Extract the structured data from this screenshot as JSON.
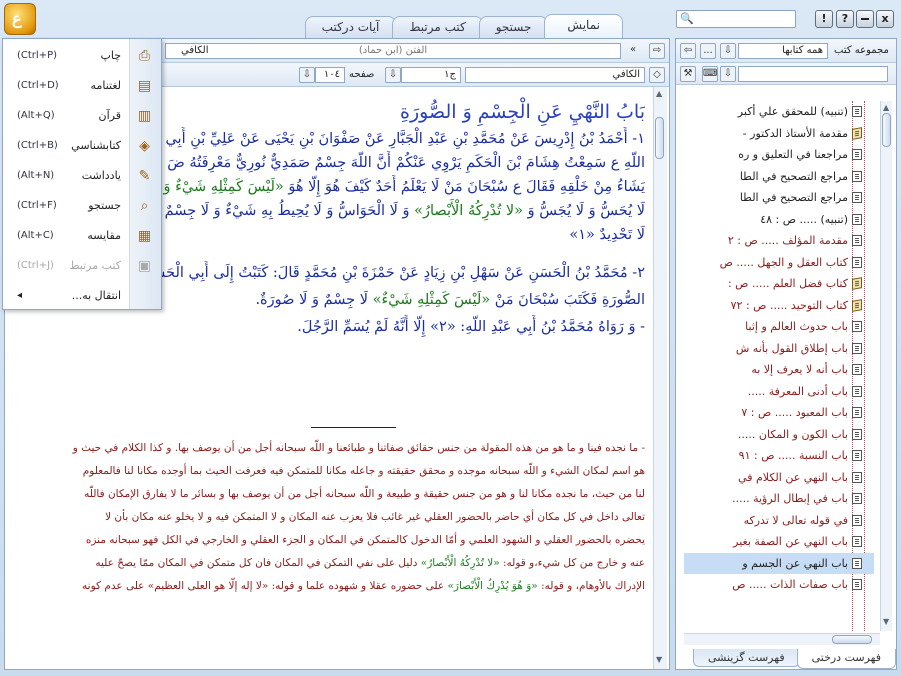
{
  "titlebar": {
    "logo_glyph": "ع",
    "tabs": [
      {
        "label": "نمایش",
        "active": true
      },
      {
        "label": "جستجو",
        "active": false
      },
      {
        "label": "کتب مرتبط",
        "active": false
      },
      {
        "label": "آیات درکتب",
        "active": false
      }
    ],
    "search_placeholder": "",
    "win_buttons": [
      "x",
      "?",
      "!"
    ]
  },
  "right_panel": {
    "collection_label": "مجموعه کتب",
    "collection_value": "همه کتابها",
    "more_label": "...",
    "tree_items": [
      {
        "label": "(تنبیه) للمحقق علي أكبر",
        "red": false,
        "icon": "page"
      },
      {
        "label": "مقدمة الأستاذ الدكتور -",
        "red": false,
        "icon": "book"
      },
      {
        "label": "مراجعنا في التعليق و ره",
        "red": false,
        "icon": "page"
      },
      {
        "label": "مراجع التصحيح في الطا",
        "red": false,
        "icon": "page"
      },
      {
        "label": "مراجع التصحيح في الطا",
        "red": false,
        "icon": "page"
      },
      {
        "label": "(تنبیه) ..... ص : ٤٨",
        "red": false,
        "icon": "page"
      },
      {
        "label": "مقدمة المؤلف ..... ص : ٢",
        "red": true,
        "icon": "page"
      },
      {
        "label": "كتاب العقل و الجهل ..... ص",
        "red": true,
        "icon": "page"
      },
      {
        "label": "كتاب فضل العلم ..... ص :",
        "red": true,
        "icon": "book"
      },
      {
        "label": "كتاب التوحيد ..... ص : ٧٢",
        "red": true,
        "icon": "book"
      },
      {
        "label": "باب حدوث العالم و إثبا",
        "red": true,
        "icon": "page"
      },
      {
        "label": "باب إطلاق القول بأنه ش",
        "red": true,
        "icon": "page"
      },
      {
        "label": "باب أنه لا يعرف إلا به",
        "red": true,
        "icon": "page"
      },
      {
        "label": "باب أدنى المعرفة .....",
        "red": true,
        "icon": "page"
      },
      {
        "label": "باب المعبود ..... ص : ٧",
        "red": true,
        "icon": "page"
      },
      {
        "label": "باب الكون و المكان .....",
        "red": true,
        "icon": "page"
      },
      {
        "label": "باب النسبة ..... ص : ٩١",
        "red": true,
        "icon": "page"
      },
      {
        "label": "باب النهي عن الكلام في",
        "red": true,
        "icon": "page"
      },
      {
        "label": "باب في إبطال الرؤية .....",
        "red": true,
        "icon": "page"
      },
      {
        "label": "في قوله تعالى لا تدركه",
        "red": true,
        "icon": "page"
      },
      {
        "label": "باب النهي عن الصفة بغير",
        "red": true,
        "icon": "page"
      },
      {
        "label": "باب النهي عن الجسم و",
        "red": false,
        "icon": "page",
        "selected": true
      },
      {
        "label": "باب صفات الذات ..... ص",
        "red": true,
        "icon": "page"
      }
    ],
    "bottom_tabs": [
      {
        "label": "فهرست درختی",
        "active": true
      },
      {
        "label": "فهرست گزینشی",
        "active": false
      }
    ]
  },
  "main_panel": {
    "book_title_field": "الكافي",
    "author_field": "الفتن (ابن حماد)",
    "book_combo": "الكافي",
    "volume_label": "ج",
    "volume_value": "١",
    "page_label": "صفحه",
    "page_value": "١٠٤",
    "heading": "بَابُ النَّهْيِ عَنِ الْجِسْمِ وَ الصُّورَةِ",
    "lines": [
      {
        "parts": [
          {
            "t": "١- أَحْمَدُ بْنُ إِدْرِيسَ عَنْ مُحَمَّدِ بْنِ عَبْدِ الْجَبَّارِ عَنْ صَفْوَانَ بْنِ يَحْيَى عَنْ عَلِيِّ بْنِ أَبِي ...",
            "c": "blue"
          }
        ]
      },
      {
        "parts": [
          {
            "t": "اللَّهِ ع سَمِعْتُ هِشَامَ بْنَ الْحَكَمِ يَرْوِي عَنْكُمْ أَنَّ اللَّهَ جِسْمٌ صَمَدِيٌّ نُورِيٌّ مَعْرِفَتُهُ ضَ",
            "c": "blue"
          }
        ]
      },
      {
        "parts": [
          {
            "t": "يَشَاءُ مِنْ خَلْقِهِ فَقَالَ ع سُبْحَانَ مَنْ لَا يَعْلَمُ أَحَدٌ كَيْفَ هُوَ إِلَّا هُوَ ",
            "c": "blue"
          },
          {
            "t": "«لَيْسَ كَمِثْلِهِ شَيْءٌ وَ هُوَ السَّمِيعُ»",
            "c": "green"
          }
        ]
      },
      {
        "parts": [
          {
            "t": "لَا يُحَسُّ وَ لَا يُجَسُّ وَ ",
            "c": "blue"
          },
          {
            "t": "«لا تُدْرِكُهُ الْأَبْصارُ»",
            "c": "green"
          },
          {
            "t": " وَ لَا الْحَوَاسُّ وَ لَا يُحِيطُ بِهِ شَيْءٌ وَ لَا جِسْمٌ وَ لَا",
            "c": "blue"
          }
        ]
      },
      {
        "parts": [
          {
            "t": "لَا تَحْدِيدٌ «١»",
            "c": "blue"
          }
        ]
      },
      {
        "parts": [
          {
            "t": "٢- مُحَمَّدُ بْنُ الْحَسَنِ عَنْ سَهْلِ بْنِ زِيَادٍ عَنْ حَمْزَةَ بْنِ مُحَمَّدٍ قَالَ: كَتَبْتُ إِلَى أَبِي الْحَسَنِ ع أَسْأَلُهُ عَنِ الْجِسْمِ وَ",
            "c": "blue"
          }
        ]
      },
      {
        "parts": [
          {
            "t": "الصُّورَةِ فَكَتَبَ سُبْحَانَ مَنْ ",
            "c": "blue"
          },
          {
            "t": "«لَيْسَ كَمِثْلِهِ شَيْءٌ»",
            "c": "green"
          },
          {
            "t": " لَا جِسْمٌ وَ لَا صُورَةٌ.",
            "c": "blue"
          }
        ]
      },
      {
        "parts": [
          {
            "t": "- وَ رَوَاهُ مُحَمَّدُ بْنُ أَبِي عَبْدِ اللَّهِ: «٢» إِلَّا أَنَّهُ لَمْ يُسَمِّ الرَّجُلَ.",
            "c": "blue"
          }
        ]
      }
    ],
    "commentary": [
      {
        "parts": [
          {
            "t": "- ما نجده فينا و ما هو من هذه المقولة من جنس حقائق صفاتنا و طبائعنا و اللّه سبحانه أجل من أن يوصف بها. و كذا الكلام في حيث و",
            "c": "red"
          }
        ]
      },
      {
        "parts": [
          {
            "t": "هو اسم لمكان الشيء و اللّه سبحانه موجده و محقق حقيقته و جاعله مكانا للمتمكن فيه فعرفت الحيث بما أوجده مكانا لنا فالمعلوم",
            "c": "red"
          }
        ]
      },
      {
        "parts": [
          {
            "t": "لنا من حيث، ما نجده مكانا لنا و هو من جنس حقيقة و طبيعة و اللّه سبحانه أجل من أن يوصف بها و بسائر ما لا يفارق الإمكان فاللّه",
            "c": "red"
          }
        ]
      },
      {
        "parts": [
          {
            "t": "تعالى داخل في كل مكان أي حاضر بالحضور العقلي غير غائب فلا يعزب عنه المكان و لا المتمكن فيه و لا يخلو عنه مكان بأن لا",
            "c": "red"
          }
        ]
      },
      {
        "parts": [
          {
            "t": "يحضره بالحضور العقلي و الشهود العلمي و أمّا الدخول كالمتمكن في المكان و الجزء العقلي و الخارجي في الكل فهو سبحانه منزه",
            "c": "red"
          }
        ]
      },
      {
        "parts": [
          {
            "t": "عنه و خارج من كل شيء،و قوله: ",
            "c": "red"
          },
          {
            "t": "«لا تُدْرِكُهُ الْأَبْصارُ»",
            "c": "green"
          },
          {
            "t": " دليل على نفي التمكن في المكان فان كل متمكن في المكان ممّا يصحّ عليه",
            "c": "red"
          }
        ]
      },
      {
        "parts": [
          {
            "t": "الإدراك بالأوهام، و قوله: ",
            "c": "red"
          },
          {
            "t": "«وَ هُوَ يُدْرِكُ الْأَبْصارَ»",
            "c": "green"
          },
          {
            "t": " على حضوره عقلا و شهوده علما و قوله: «لا إله إلّا هو العلى العظيم» على عدم كونه",
            "c": "red"
          }
        ]
      }
    ]
  },
  "menu": {
    "items": [
      {
        "label": "چاپ",
        "shortcut": "(Ctrl+P)",
        "icon": "print-icon",
        "disabled": false
      },
      {
        "label": "لغتنامه",
        "shortcut": "(Ctrl+D)",
        "icon": "dictionary-icon",
        "disabled": false
      },
      {
        "label": "قرآن",
        "shortcut": "(Alt+Q)",
        "icon": "quran-icon",
        "disabled": false
      },
      {
        "label": "كتابشناسي",
        "shortcut": "(Ctrl+B)",
        "icon": "bibliography-icon",
        "disabled": false
      },
      {
        "label": "يادداشت",
        "shortcut": "(Alt+N)",
        "icon": "note-icon",
        "disabled": false
      },
      {
        "label": "جستجو",
        "shortcut": "(Ctrl+F)",
        "icon": "search-icon",
        "disabled": false
      },
      {
        "label": "مقايسه",
        "shortcut": "(Alt+C)",
        "icon": "compare-icon",
        "disabled": false
      },
      {
        "label": "كتب مرتبط",
        "shortcut": "(Ctrl+J)",
        "icon": "related-books-icon",
        "disabled": true
      },
      {
        "label": "انتقال به...",
        "shortcut": "",
        "icon": "",
        "disabled": false,
        "submenu": true
      }
    ]
  },
  "colors": {
    "blue_text": "#1b2e9e",
    "red_text": "#8b1a1a",
    "green_text": "#1c7a1c",
    "panel_border": "#8ea8c6"
  }
}
